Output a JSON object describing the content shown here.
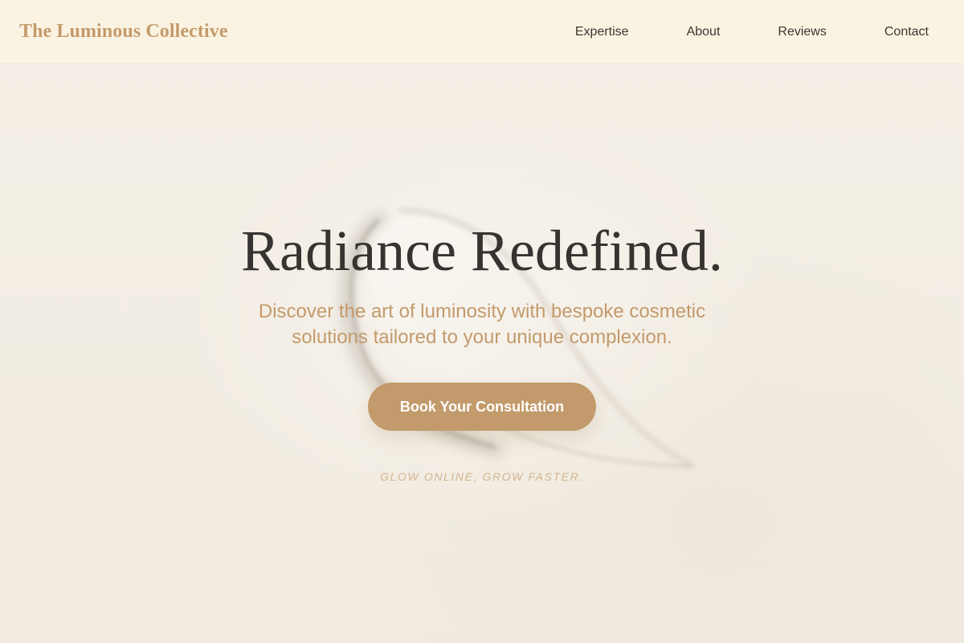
{
  "header": {
    "brand": "The Luminous Collective",
    "nav": [
      {
        "label": "Expertise"
      },
      {
        "label": "About"
      },
      {
        "label": "Reviews"
      },
      {
        "label": "Contact"
      }
    ]
  },
  "hero": {
    "title": "Radiance Redefined.",
    "subtitle": "Discover the art of luminosity with bespoke cosmetic solutions tailored to your unique complexion.",
    "cta_label": "Book Your Consultation",
    "tagline": "GLOW ONLINE, GROW FASTER."
  },
  "colors": {
    "accent": "#c39a6b",
    "header_bg": "#fbf3e2",
    "page_bg": "#f3eee6",
    "title_text": "#363330",
    "nav_text": "#3a3632",
    "tagline": "#d4b48f"
  }
}
